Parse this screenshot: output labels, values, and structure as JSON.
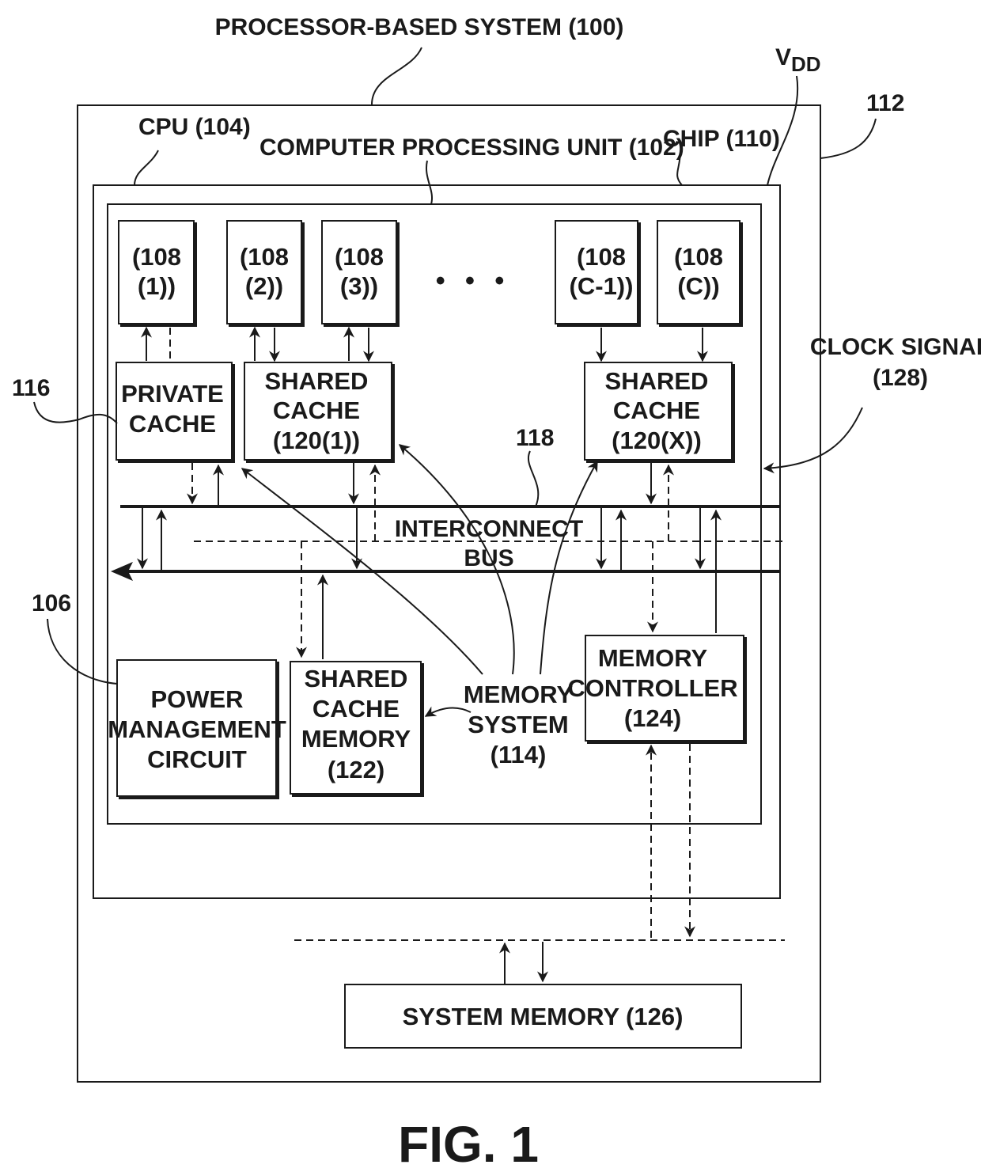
{
  "figure": {
    "caption": "FIG. 1",
    "title": "PROCESSOR-BASED SYSTEM (100)"
  },
  "labels": {
    "cpu": "CPU (104)",
    "computer_processing_unit": "COMPUTER PROCESSING UNIT (102)",
    "chip": "CHIP (110)",
    "vdd_main": "V",
    "vdd_sub": "DD",
    "ref_112": "112",
    "ref_116": "116",
    "ref_118": "118",
    "ref_106": "106",
    "clock_signal_line1": "CLOCK SIGNAL",
    "clock_signal_line2": "(128)",
    "memory_system_line1": "MEMORY",
    "memory_system_line2": "SYSTEM",
    "memory_system_line3": "(114)",
    "interconnect_line1": "INTERCONNECT",
    "interconnect_line2": "BUS",
    "ellipsis": "• • •"
  },
  "cores": [
    {
      "line1": "(108",
      "line2": "(1))"
    },
    {
      "line1": "(108",
      "line2": "(2))"
    },
    {
      "line1": "(108",
      "line2": "(3))"
    },
    {
      "line1": "(108",
      "line2": "(C-1))"
    },
    {
      "line1": "(108",
      "line2": "(C))"
    }
  ],
  "blocks": {
    "private_cache": [
      "PRIVATE",
      "CACHE"
    ],
    "shared_cache_1": [
      "SHARED",
      "CACHE",
      "(120(1))"
    ],
    "shared_cache_x": [
      "SHARED",
      "CACHE",
      "(120(X))"
    ],
    "power_management": [
      "POWER",
      "MANAGEMENT",
      "CIRCUIT"
    ],
    "shared_cache_memory": [
      "SHARED",
      "CACHE",
      "MEMORY",
      "(122)"
    ],
    "memory_controller": [
      "MEMORY",
      "CONTROLLER",
      "(124)"
    ],
    "system_memory": "SYSTEM MEMORY (126)"
  }
}
